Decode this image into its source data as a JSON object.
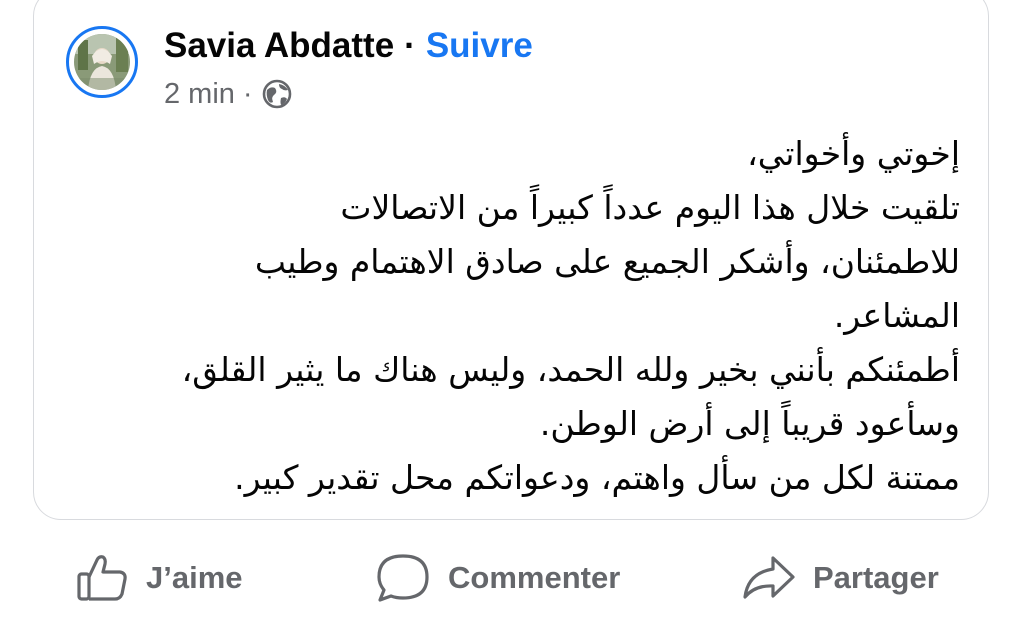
{
  "post": {
    "author": "Savia Abdatte",
    "separator": "·",
    "follow_label": "Suivre",
    "time": "2 min",
    "meta_separator": "·",
    "privacy_icon": "globe-icon",
    "body_lines": [
      "إخوتي وأخواتي،",
      "تلقيت خلال هذا اليوم عدداً كبيراً من الاتصالات",
      "للاطمئنان، وأشكر الجميع على صادق الاهتمام وطيب",
      "المشاعر.",
      "أطمئنكم بأنني بخير ولله الحمد، وليس هناك ما يثير القلق،",
      "وسأعود قريباً إلى أرض الوطن.",
      "ممتنة لكل من سأل واهتم، ودعواتكم محل تقدير كبير."
    ]
  },
  "actions": {
    "like_label": "J’aime",
    "comment_label": "Commenter",
    "share_label": "Partager",
    "like_icon": "thumbs-up-icon",
    "comment_icon": "speech-bubble-icon",
    "share_icon": "share-arrow-icon"
  },
  "colors": {
    "accent": "#1877f2",
    "text": "#050505",
    "secondary": "#65676b",
    "border": "#d8dade"
  }
}
